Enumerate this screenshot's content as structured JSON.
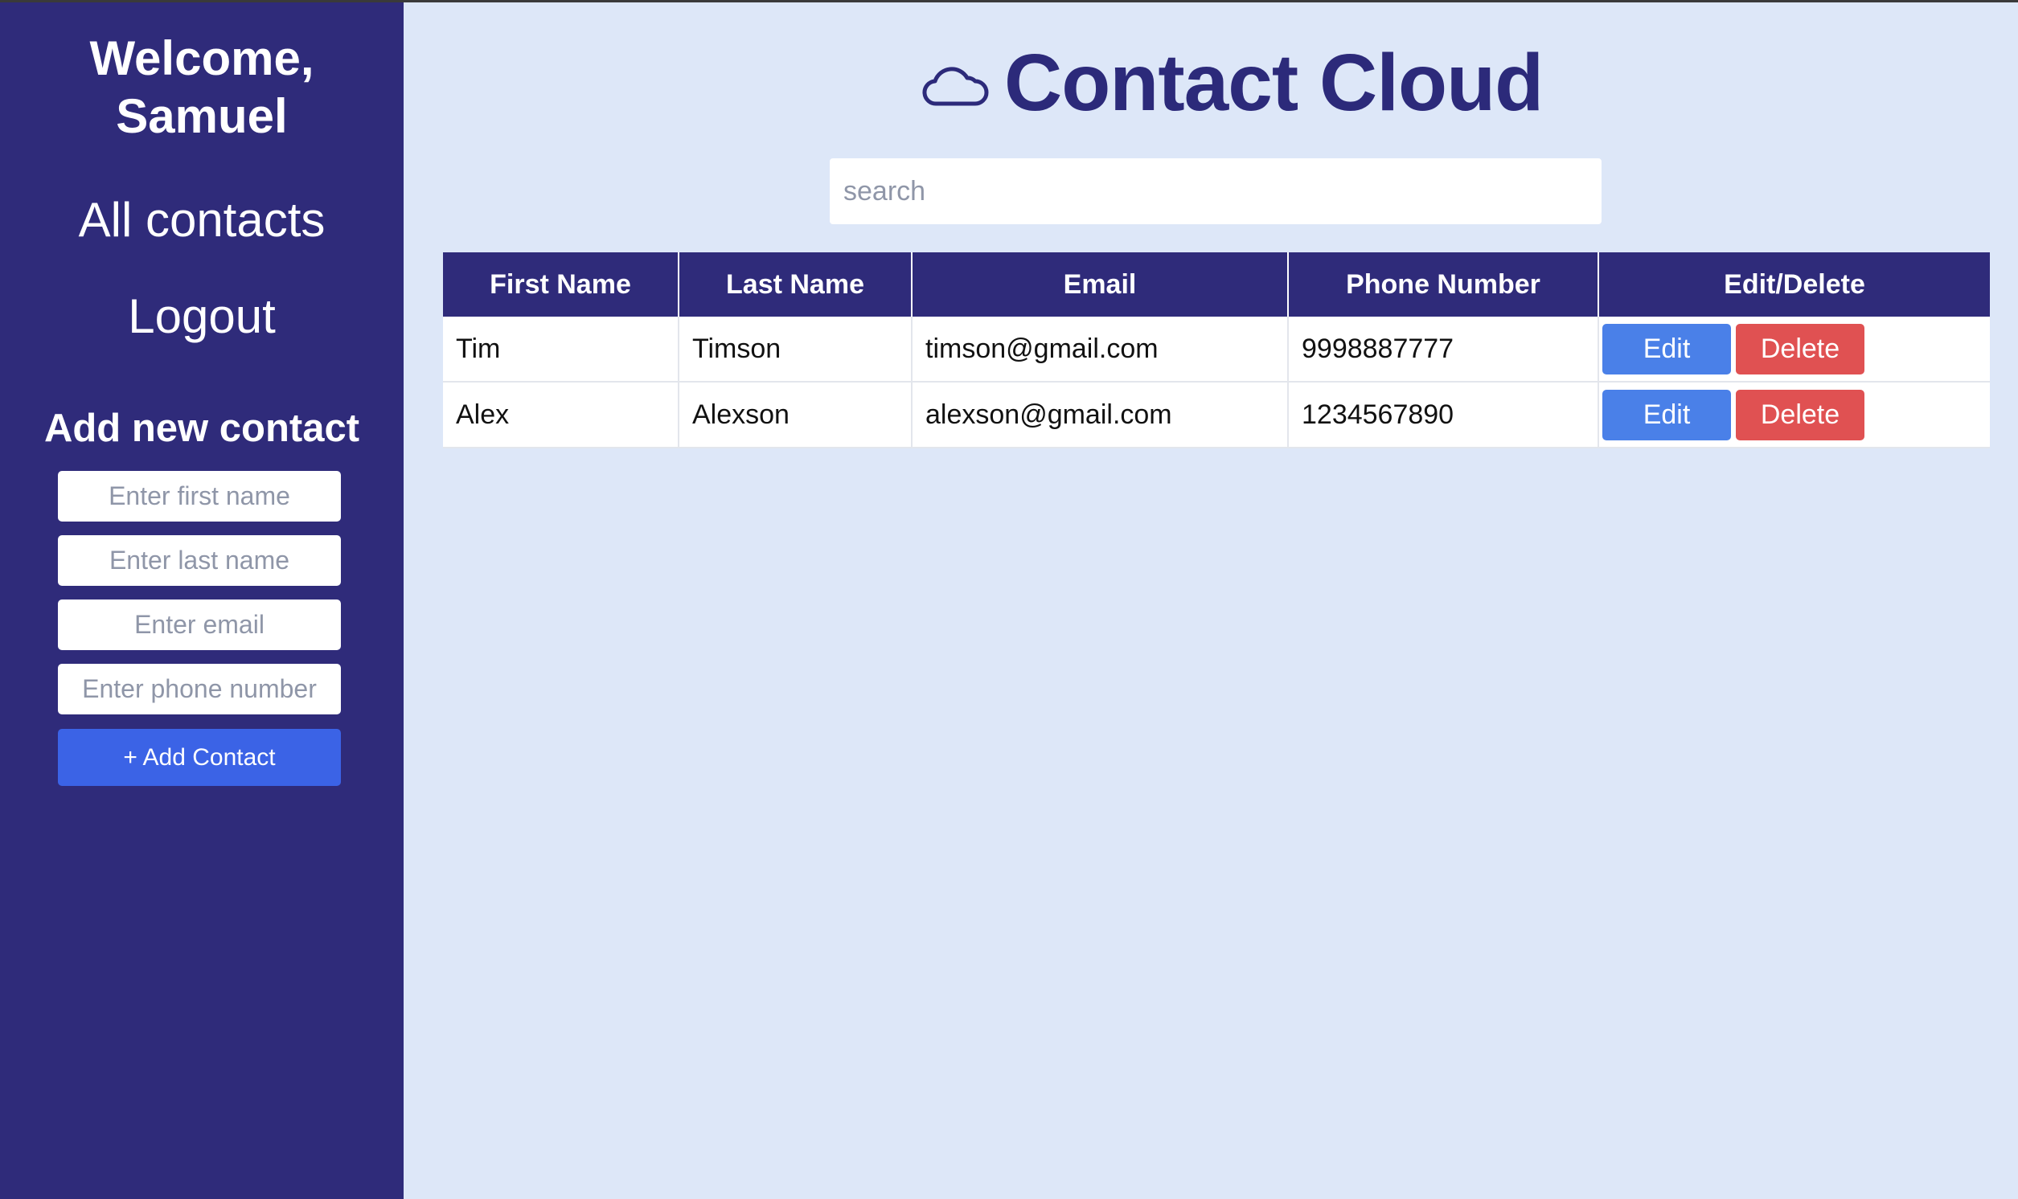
{
  "sidebar": {
    "welcome": "Welcome, Samuel",
    "nav": {
      "all_contacts": "All contacts",
      "logout": "Logout"
    },
    "add_form": {
      "title": "Add new contact",
      "first_name_placeholder": "Enter first name",
      "last_name_placeholder": "Enter last name",
      "email_placeholder": "Enter email",
      "phone_placeholder": "Enter phone number",
      "add_button": "+ Add Contact"
    }
  },
  "main": {
    "title": "Contact Cloud",
    "title_icon": "cloud-icon",
    "search_placeholder": "search",
    "table": {
      "headers": [
        "First Name",
        "Last Name",
        "Email",
        "Phone Number",
        "Edit/Delete"
      ],
      "rows": [
        {
          "first": "Tim",
          "last": "Timson",
          "email": "timson@gmail.com",
          "phone": "9998887777",
          "edit": "Edit",
          "delete": "Delete"
        },
        {
          "first": "Alex",
          "last": "Alexson",
          "email": "alexson@gmail.com",
          "phone": "1234567890",
          "edit": "Edit",
          "delete": "Delete"
        }
      ]
    }
  },
  "colors": {
    "sidebar_bg": "#2f2b7a",
    "main_bg": "#dde7f8",
    "title_color": "#2c2a7a",
    "add_button": "#3b63e6",
    "edit_button": "#4a80e8",
    "delete_button": "#e05152"
  }
}
